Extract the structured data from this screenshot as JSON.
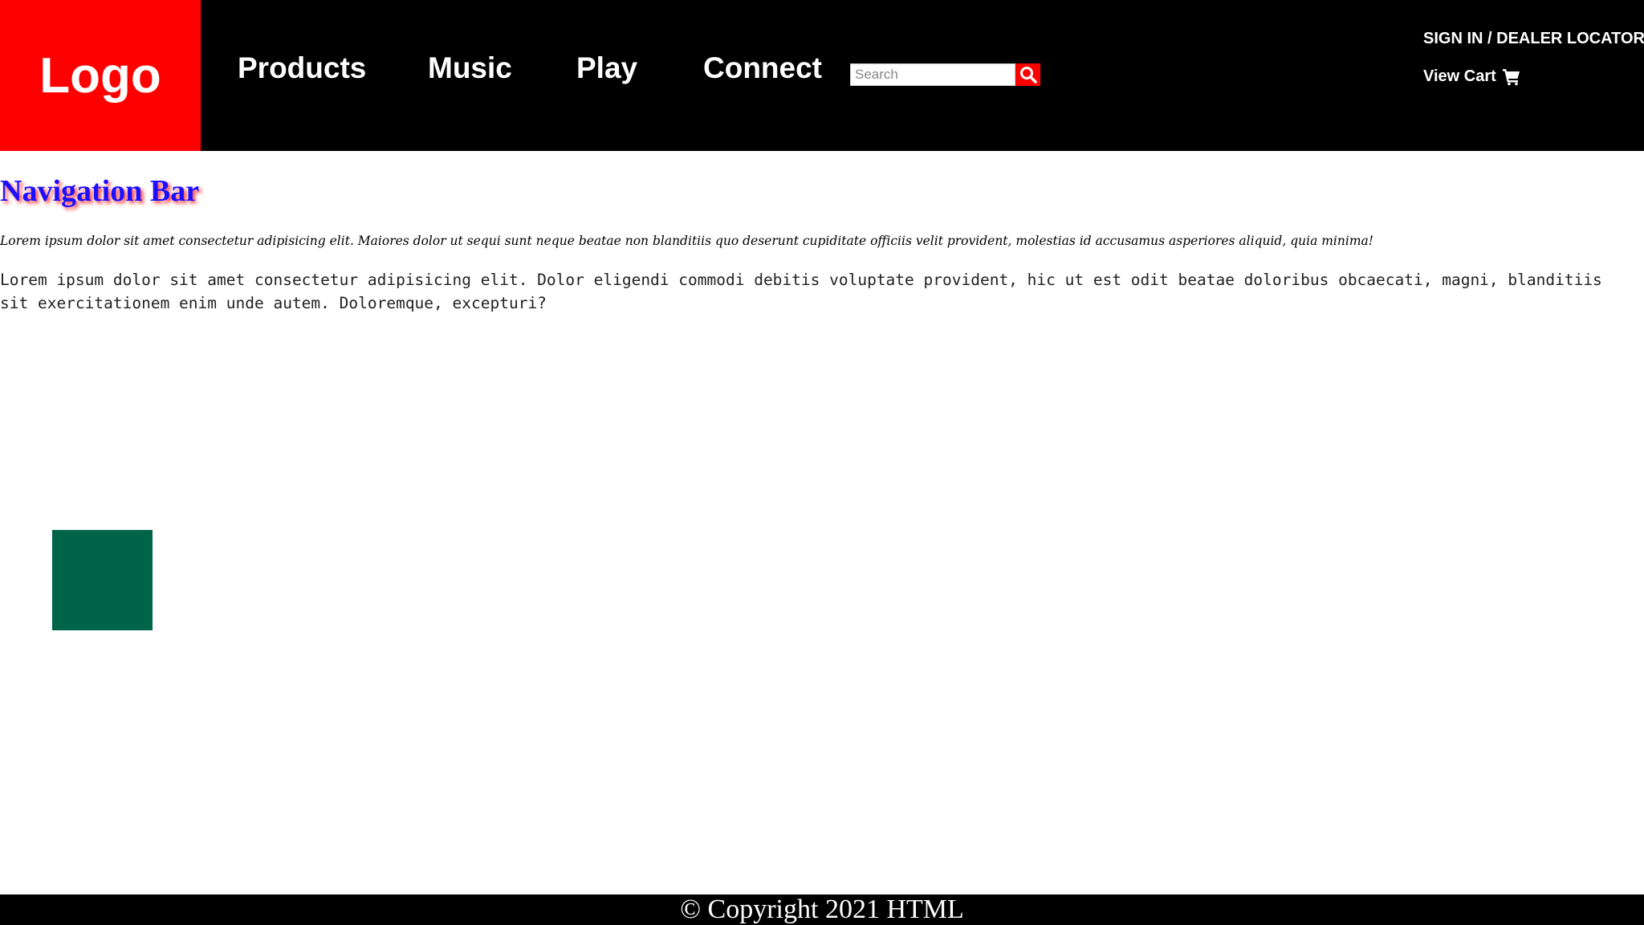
{
  "header": {
    "logo_text": "Logo",
    "nav_items": [
      {
        "label": "Products"
      },
      {
        "label": "Music"
      },
      {
        "label": "Play"
      },
      {
        "label": "Connect"
      }
    ],
    "search": {
      "placeholder": "Search",
      "value": "",
      "button_icon": "search-icon"
    },
    "sign_in_label": "SIGN IN / DEALER LOCATOR",
    "cart_label": "View Cart",
    "cart_icon": "cart-icon"
  },
  "main": {
    "heading": "Navigation Bar",
    "paragraph_1": "Lorem ipsum dolor sit amet consectetur adipisicing elit. Maiores dolor ut sequi sunt neque beatae non blanditiis quo deserunt cupiditate officiis velit provident, molestias id accusamus asperiores aliquid, quia minima!",
    "paragraph_2": "Lorem ipsum dolor sit amet consectetur adipisicing elit. Dolor eligendi commodi debitis voluptate provident, hic ut est odit beatae doloribus obcaecati, magni, blanditiis sit exercitationem enim unde autem. Doloremque, excepturi?"
  },
  "footer": {
    "copyright": "© Copyright 2021 HTML"
  },
  "colors": {
    "header_bg": "#000000",
    "logo_bg": "#ff0000",
    "heading_text": "#1a10ff",
    "heading_shadow": "#ff3b3b",
    "green_box": "#006548",
    "footer_bg": "#000000"
  }
}
